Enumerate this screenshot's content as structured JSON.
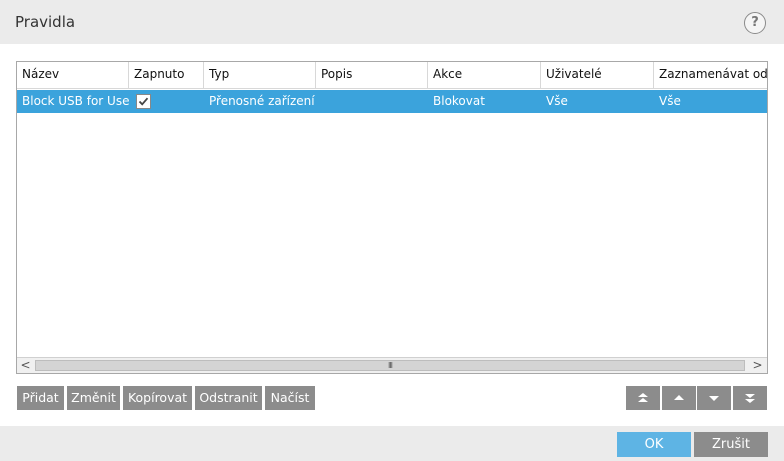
{
  "window": {
    "title": "Pravidla",
    "help_glyph": "?"
  },
  "table": {
    "columns": [
      "Název",
      "Zapnuto",
      "Typ",
      "Popis",
      "Akce",
      "Uživatelé",
      "Zaznamenávat od úr"
    ],
    "rows": [
      {
        "name": "Block USB for User",
        "enabled": true,
        "type": "Přenosné zařízení",
        "description": "",
        "action": "Blokovat",
        "users": "Vše",
        "log_from": "Vše",
        "selected": true
      }
    ],
    "scrollbar": {
      "left_arrow": "<",
      "right_arrow": ">",
      "grip": "III"
    }
  },
  "actions": {
    "add": "Přidat",
    "edit": "Změnit",
    "copy": "Kopírovat",
    "remove": "Odstranit",
    "load": "Načíst"
  },
  "order_buttons": [
    "move-top-icon",
    "move-up-icon",
    "move-down-icon",
    "move-bottom-icon"
  ],
  "footer": {
    "ok": "OK",
    "cancel": "Zrušit"
  },
  "colors": {
    "selection": "#3ba3dc",
    "ok": "#5eb4e4",
    "button": "#8c8c8c"
  }
}
